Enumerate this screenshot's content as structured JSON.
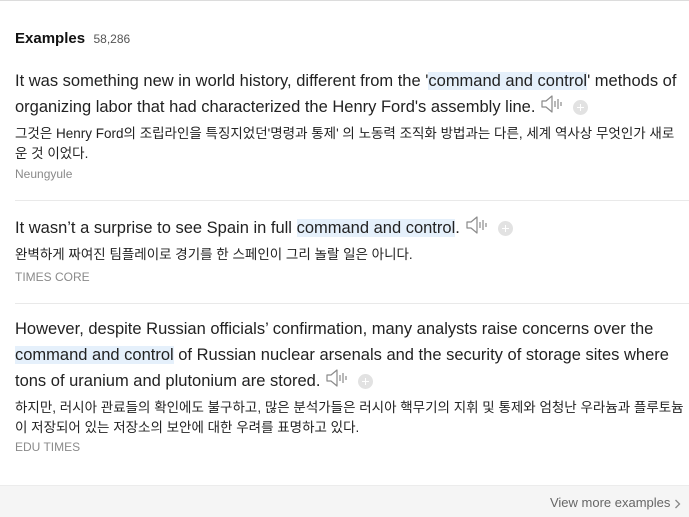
{
  "header": {
    "title": "Examples",
    "count": "58,286"
  },
  "examples": [
    {
      "en_before": "It was something new in world history, different from the '",
      "en_highlight": "command and control",
      "en_after": "' methods of organizing labor that had characterized the Henry Ford's assembly line.",
      "ko": "그것은 Henry Ford의 조립라인을 특징지었던'명령과 통제' 의 노동력 조직화 방법과는 다른, 세계 역사상 무엇인가 새로운 것 이었다.",
      "source": "Neungyule"
    },
    {
      "en_before": "It wasn’t a surprise to see Spain in full ",
      "en_highlight": "command and control",
      "en_after": ".",
      "ko": "완벽하게 짜여진 팀플레이로 경기를 한 스페인이 그리 놀랄 일은 아니다.",
      "source": "TIMES CORE"
    },
    {
      "en_before": "However, despite Russian officials’ confirmation, many analysts raise concerns over the ",
      "en_highlight": "command and control",
      "en_after": " of Russian nuclear arsenals and the security of storage sites where tons of uranium and plutonium are stored.",
      "ko": "하지만, 러시아 관료들의 확인에도 불구하고, 많은 분석가들은 러시아 핵무기의 지휘 및 통제와 엄청난 우라늄과 플루토늄이 저장되어 있는 저장소의 보안에 대한 우려를 표명하고 있다.",
      "source": "EDU TIMES"
    }
  ],
  "footer": {
    "view_more": "View more examples"
  },
  "icons": {
    "speaker": "speaker-icon",
    "add": "plus-circle-icon",
    "chevron": "chevron-right-icon"
  },
  "colors": {
    "highlight": "#e5f0fb"
  }
}
